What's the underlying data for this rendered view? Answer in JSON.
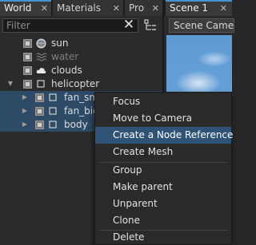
{
  "left_tabs": [
    {
      "label": "World",
      "active": true
    },
    {
      "label": "Materials",
      "active": false
    },
    {
      "label": "Pro",
      "active": false
    }
  ],
  "filter": {
    "placeholder": "Filter",
    "value": ""
  },
  "tree": [
    {
      "label": "sun",
      "icon": "sun-icon",
      "expand": "none",
      "dim": false,
      "selected": false
    },
    {
      "label": "water",
      "icon": "water-icon",
      "expand": "none",
      "dim": true,
      "selected": false
    },
    {
      "label": "clouds",
      "icon": "cloud-icon",
      "expand": "none",
      "dim": false,
      "selected": false
    },
    {
      "label": "helicopter",
      "icon": "node-icon",
      "expand": "expanded",
      "dim": false,
      "selected": false
    },
    {
      "label": "fan_small",
      "icon": "node-icon",
      "expand": "collapsed",
      "dim": false,
      "selected": true
    },
    {
      "label": "fan_big",
      "icon": "node-icon",
      "expand": "collapsed",
      "dim": false,
      "selected": true
    },
    {
      "label": "body",
      "icon": "node-icon",
      "expand": "collapsed",
      "dim": false,
      "selected": true
    }
  ],
  "right_tab": {
    "label": "Scene 1"
  },
  "scene_camera": "Scene Camera",
  "context_menu": {
    "items": [
      {
        "label": "Focus",
        "hover": false
      },
      {
        "label": "Move to Camera",
        "hover": false
      },
      {
        "label": "Create a Node Reference",
        "hover": true
      },
      {
        "label": "Create Mesh",
        "hover": false
      },
      {
        "separator": true
      },
      {
        "label": "Group",
        "hover": false
      },
      {
        "label": "Make parent",
        "hover": false
      },
      {
        "label": "Unparent",
        "hover": false
      },
      {
        "label": "Clone",
        "hover": false
      },
      {
        "separator": true
      },
      {
        "label": "Delete",
        "hover": false
      }
    ]
  },
  "colors": {
    "accent": "#4a90d9",
    "selection": "#2d4a67",
    "menu_hover": "#2f5277"
  }
}
